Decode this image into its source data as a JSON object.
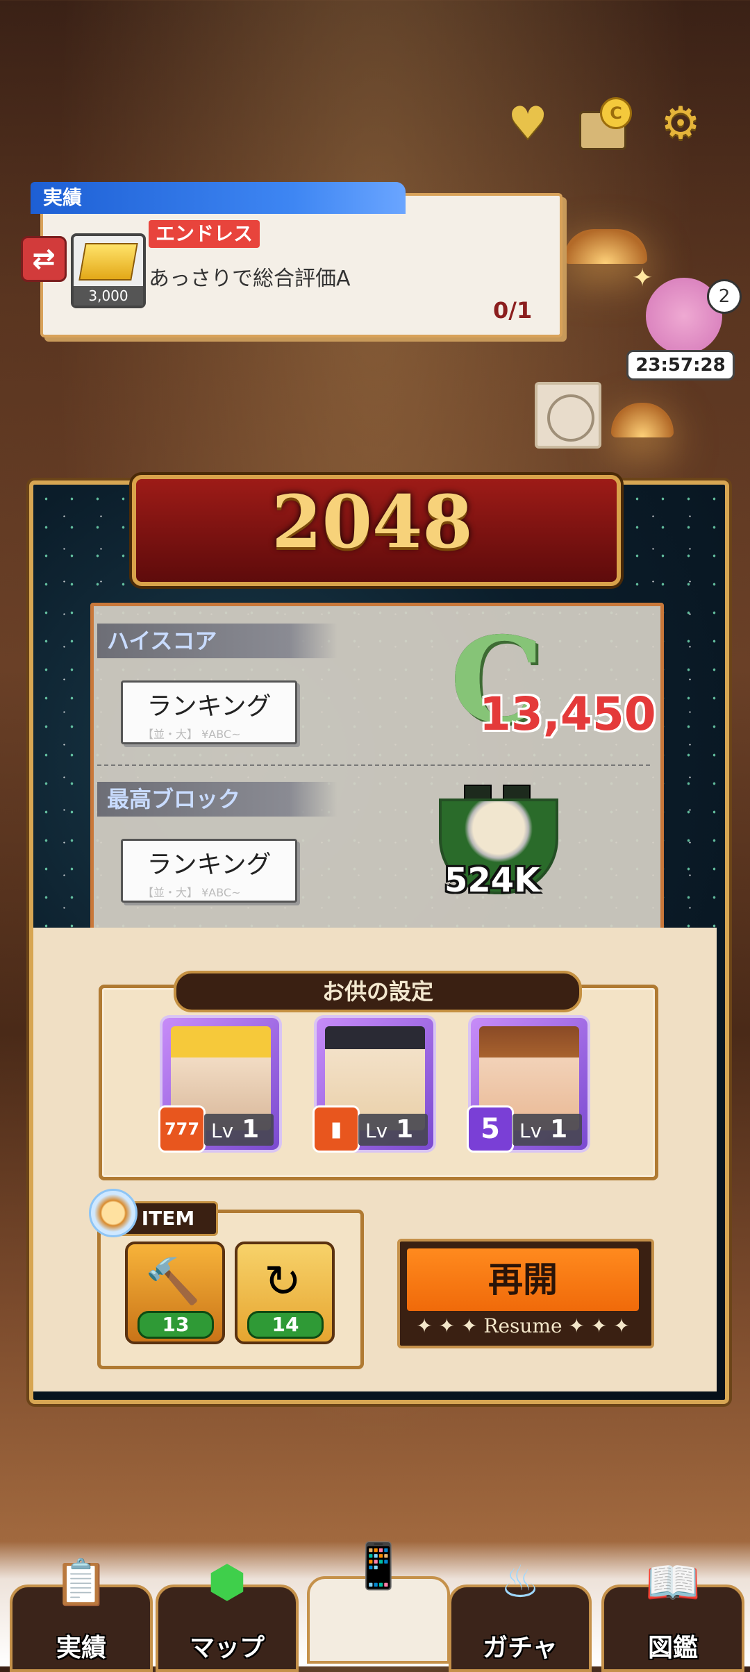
{
  "top_icons": {
    "heart": "heart-icon",
    "shop": "shop-icon",
    "settings": "gear-icon"
  },
  "achievement": {
    "tab_label": "実績",
    "reward_count": "3,000",
    "badge": "エンドレス",
    "description": "あっさりで総合評価A",
    "progress": "0/1"
  },
  "character_event": {
    "badge_count": "2",
    "timer": "23:57:28"
  },
  "game": {
    "title": "2048",
    "highscore_label": "ハイスコア",
    "highscore_rank_button": "ランキング",
    "grade": "C",
    "score": "13,450",
    "max_block_label": "最高ブロック",
    "max_block_rank_button": "ランキング",
    "max_block_value": "524K",
    "rank_button_subtext": "【並・大】 ¥ABC~"
  },
  "party": {
    "title": "お供の設定",
    "lv_label": "Lv",
    "members": [
      {
        "level": "1",
        "skill": "777",
        "skill_color": "#e8561e"
      },
      {
        "level": "1",
        "skill": "card",
        "skill_color": "#e8561e"
      },
      {
        "level": "1",
        "skill": "5",
        "skill_color": "#7a3fd6"
      }
    ]
  },
  "items": {
    "label": "ITEM",
    "list": [
      {
        "name": "hammer-icon",
        "count": "13"
      },
      {
        "name": "swap-bowl-icon",
        "count": "14"
      }
    ]
  },
  "resume_button": {
    "label": "再開",
    "sub": "Resume"
  },
  "nav": [
    {
      "label": "実績",
      "icon": "clipboard-icon"
    },
    {
      "label": "マップ",
      "icon": "map-gem-icon"
    },
    {
      "label": "",
      "icon": "mode-select-icon"
    },
    {
      "label": "ガチャ",
      "icon": "gacha-icon"
    },
    {
      "label": "図鑑",
      "icon": "book-icon"
    }
  ],
  "colors": {
    "accent_gold": "#d7a653",
    "score_red": "#e43a3a",
    "grade_green": "#86c477",
    "resume_orange": "#f06a0a"
  }
}
